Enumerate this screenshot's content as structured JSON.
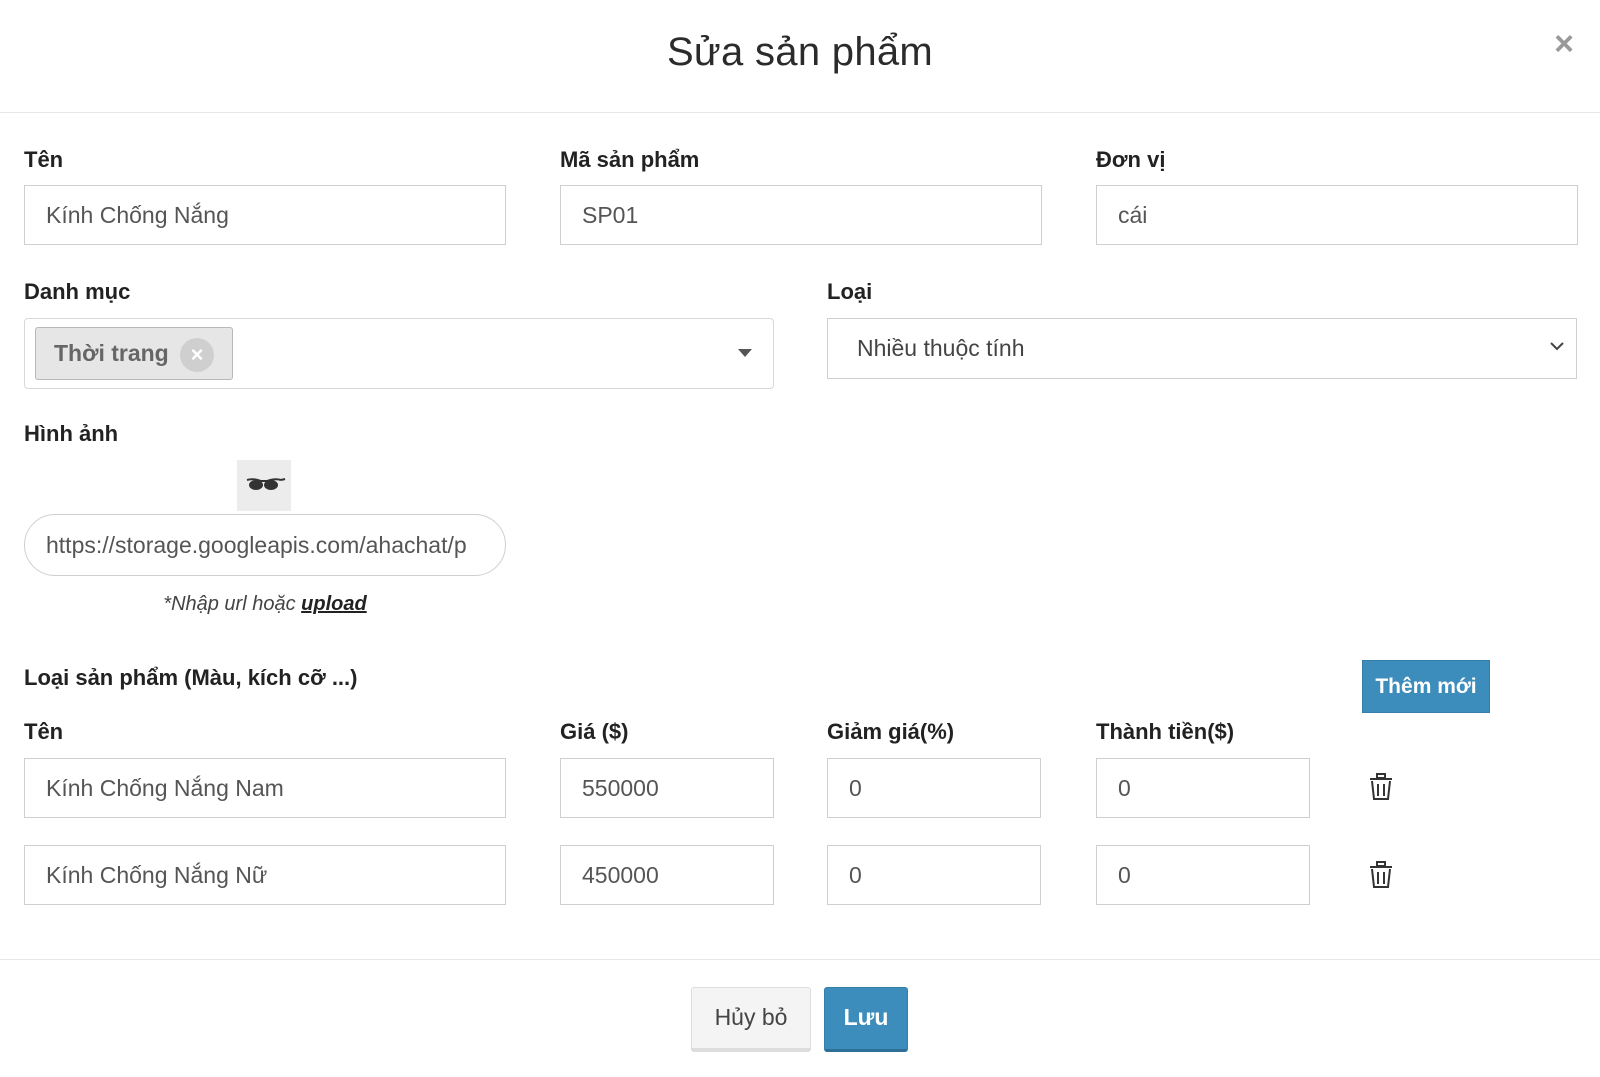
{
  "modal": {
    "title": "Sửa sản phẩm",
    "close_symbol": "×"
  },
  "fields": {
    "name": {
      "label": "Tên",
      "value": "Kính Chống Nắng"
    },
    "code": {
      "label": "Mã sản phẩm",
      "value": "SP01"
    },
    "unit": {
      "label": "Đơn vị",
      "value": "cái"
    },
    "category": {
      "label": "Danh mục",
      "tag": "Thời trang",
      "remove_symbol": "×"
    },
    "type": {
      "label": "Loại",
      "value": "Nhiều thuộc tính"
    },
    "image": {
      "label": "Hình ảnh",
      "url": "https://storage.googleapis.com/ahachat/p",
      "hint_prefix": "*Nhập url hoặc ",
      "hint_link": "upload"
    }
  },
  "variants": {
    "section_label": "Loại sản phẩm (Màu, kích cỡ ...)",
    "add_button": "Thêm mới",
    "columns": [
      "Tên",
      "Giá ($)",
      "Giảm giá(%)",
      "Thành tiền($)"
    ],
    "rows": [
      {
        "name": "Kính Chống Nắng Nam",
        "price": "550000",
        "discount": "0",
        "total": "0"
      },
      {
        "name": "Kính Chống Nắng Nữ",
        "price": "450000",
        "discount": "0",
        "total": "0"
      }
    ]
  },
  "footer": {
    "cancel": "Hủy bỏ",
    "save": "Lưu"
  },
  "colors": {
    "primary": "#3d8dbc",
    "border": "#cfcfcf",
    "tag_bg": "#e6e6e6"
  },
  "icons": {
    "close": "close-icon",
    "tag_remove": "remove-tag-icon",
    "dropdown": "caret-down-icon",
    "select": "chevron-down-icon",
    "image": "sunglasses-icon",
    "delete": "trash-icon"
  }
}
